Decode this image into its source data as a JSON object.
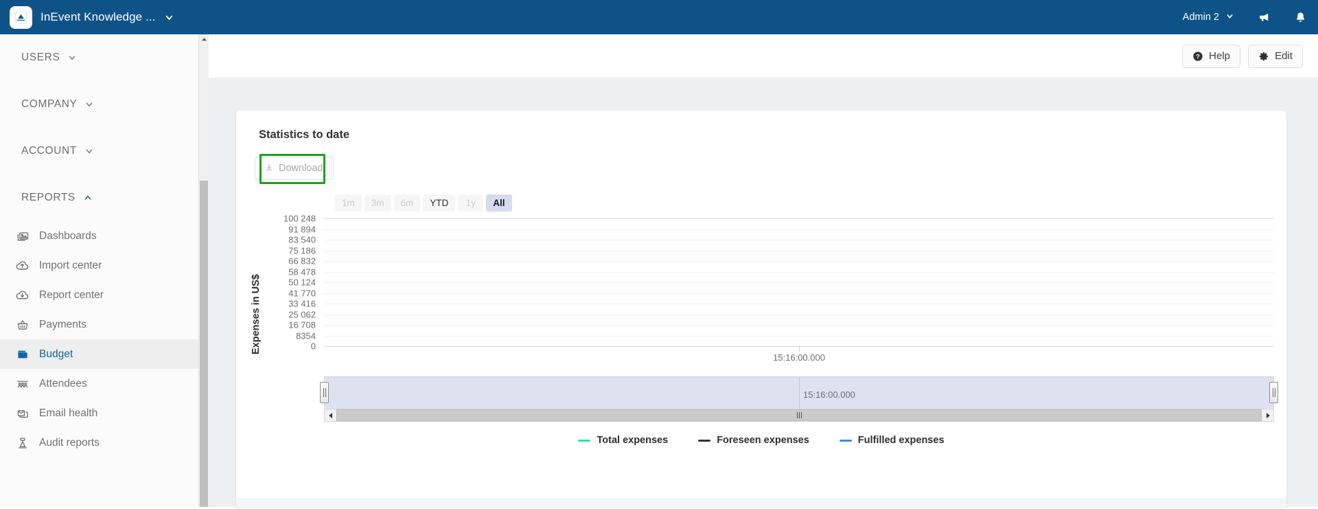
{
  "topbar": {
    "app_title": "InEvent Knowledge ...",
    "logo_icon": "inevent-logo-icon",
    "app_chevron_icon": "chevron-down-icon",
    "user_name": "Admin 2",
    "user_chevron_icon": "chevron-down-icon",
    "announcements_icon": "megaphone-icon",
    "notifications_icon": "bell-icon",
    "bg_color": "#0e5388"
  },
  "sidebar": {
    "sections": [
      {
        "label": "USERS",
        "chevron_icon": "chevron-down-icon",
        "expanded": false
      },
      {
        "label": "COMPANY",
        "chevron_icon": "chevron-down-icon",
        "expanded": false
      },
      {
        "label": "ACCOUNT",
        "chevron_icon": "chevron-down-icon",
        "expanded": false
      },
      {
        "label": "REPORTS",
        "chevron_icon": "chevron-up-icon",
        "expanded": true
      }
    ],
    "items": [
      {
        "label": "Dashboards",
        "icon": "dashboards-icon",
        "active": false
      },
      {
        "label": "Import center",
        "icon": "cloud-upload-icon",
        "active": false
      },
      {
        "label": "Report center",
        "icon": "cloud-download-icon",
        "active": false
      },
      {
        "label": "Payments",
        "icon": "basket-icon",
        "active": false
      },
      {
        "label": "Budget",
        "icon": "wallet-icon",
        "active": true
      },
      {
        "label": "Attendees",
        "icon": "attendees-icon",
        "active": false
      },
      {
        "label": "Email health",
        "icon": "mail-stack-icon",
        "active": false
      },
      {
        "label": "Audit reports",
        "icon": "audit-icon",
        "active": false
      }
    ],
    "active_color": "#1164a3",
    "scrollbar": {
      "up_arrow_icon": "caret-up-icon"
    }
  },
  "toolbar": {
    "help_label": "Help",
    "help_icon": "question-circle-icon",
    "edit_label": "Edit",
    "edit_icon": "gear-icon"
  },
  "card": {
    "title": "Statistics to date",
    "download": {
      "label": "Download",
      "icon": "download-arrow-icon",
      "disabled": true,
      "highlight_color": "#18a318"
    }
  },
  "chart_data": {
    "type": "line",
    "title": "Statistics to date",
    "xlabel": "",
    "ylabel": "Expenses in US$",
    "grid": true,
    "legend_position": "bottom",
    "ylim": [
      0,
      100248
    ],
    "y_ticks": [
      "100 248",
      "91 894",
      "83 540",
      "75 186",
      "66 832",
      "58 478",
      "50 124",
      "41 770",
      "33 416",
      "25 062",
      "16 708",
      "8354",
      "0"
    ],
    "y_tick_values": [
      100248,
      91894,
      83540,
      75186,
      66832,
      58478,
      50124,
      41770,
      33416,
      25062,
      16708,
      8354,
      0
    ],
    "x_ticks": [
      "15:16:00.000"
    ],
    "series": [
      {
        "name": "Total expenses",
        "color": "#2ee0a6",
        "values": []
      },
      {
        "name": "Foreseen expenses",
        "color": "#2d3440",
        "values": []
      },
      {
        "name": "Fulfilled expenses",
        "color": "#2f90e8",
        "values": []
      }
    ],
    "range_buttons": [
      {
        "label": "1m",
        "state": "disabled"
      },
      {
        "label": "3m",
        "state": "disabled"
      },
      {
        "label": "6m",
        "state": "disabled"
      },
      {
        "label": "YTD",
        "state": "enabled"
      },
      {
        "label": "1y",
        "state": "disabled"
      },
      {
        "label": "All",
        "state": "selected"
      }
    ],
    "navigator": {
      "label": "15:16:00.000",
      "left_handle_icon": "range-handle-icon",
      "right_handle_icon": "range-handle-icon",
      "scroll_left_icon": "caret-left-icon",
      "scroll_right_icon": "caret-right-icon",
      "thumb_grip_icon": "grip-icon"
    }
  }
}
